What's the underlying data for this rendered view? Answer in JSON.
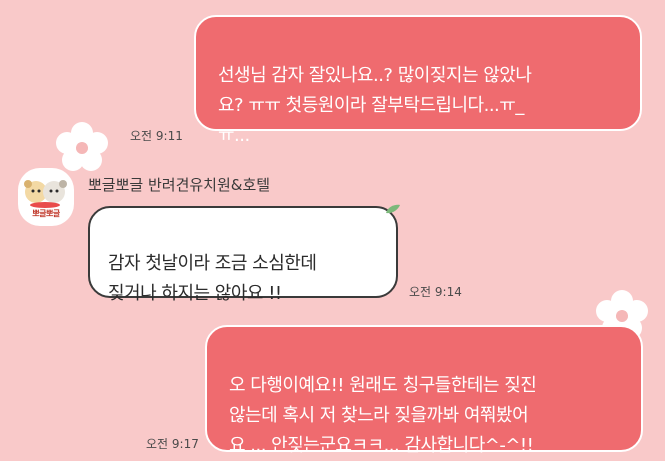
{
  "colors": {
    "background": "#f9c9c9",
    "outgoing_bubble": "#ef6b6f",
    "incoming_bubble": "#ffffff"
  },
  "messages": [
    {
      "direction": "out",
      "text": "선생님 감자 잘있나요..? 많이짖지는 않았나\n요? ㅠㅠ 첫등원이라 잘부탁드립니다...ㅠ_\nㅠ...",
      "time": "오전 9:11"
    },
    {
      "direction": "in",
      "sender": "뽀글뽀글 반려견유치원&호텔",
      "avatar_label": "뽀글뽀글",
      "text": "감자 첫날이라 조금 소심한데\n짖거나 하지는 않아요 !!",
      "time": "오전 9:14"
    },
    {
      "direction": "out",
      "text": "오 다행이예요!! 원래도 칭구들한테는 짖진\n않는데 혹시 저 찾느라 짖을까봐 여쭤봤어\n요 ... 안짖는군요ㅋㅋ... 감사합니다^-^!!",
      "time": "오전 9:17"
    }
  ],
  "icons": {
    "decoration": "flower-icon",
    "avatar": "puppy-logo-icon",
    "bubble_accent": "leaf-icon"
  }
}
